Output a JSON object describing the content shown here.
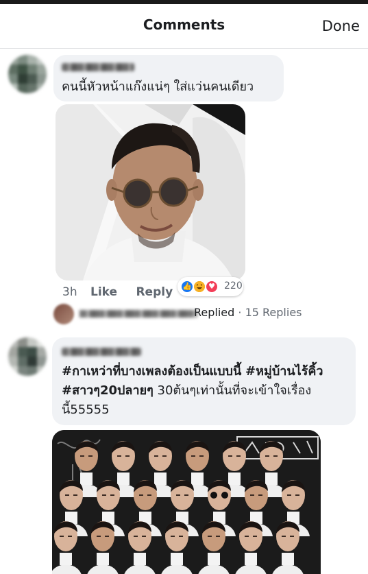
{
  "header": {
    "title": "Comments",
    "done_label": "Done"
  },
  "comments": [
    {
      "author_name_visible": false,
      "text": "คนนี้หัวหน้าแก๊งแน่ๆ ใส่แว่นคนเดียว",
      "has_photo": true,
      "time": "3h",
      "like_label": "Like",
      "reply_label": "Reply",
      "reactions": {
        "icons": [
          "like-reaction-icon",
          "haha-reaction-icon",
          "love-reaction-icon"
        ],
        "count": "220"
      },
      "replies": {
        "replied_label": "Replied",
        "separator": "·",
        "count_label": "15 Replies"
      }
    },
    {
      "author_name_visible": false,
      "hashtag1": "#กาเหว่าที่บางเพลงต้องเป็นแบบนี้",
      "hashtag2": "#หมู่บ้านไร้คิ้ว",
      "hashtag3": "#สาวๆ20ปลายๆ",
      "text_line2_rest": " 30ต้นๆเท่านั้นที่จะเข้าใจเรื่อง",
      "text_line3": "นี้55555",
      "has_photo": true
    }
  ],
  "colors": {
    "bubble_bg": "#f0f2f5",
    "text": "#1c1e21",
    "meta_text": "#606770",
    "like_blue": "#1877f2",
    "love_red": "#f33e58",
    "haha_yellow": "#f7b125"
  }
}
